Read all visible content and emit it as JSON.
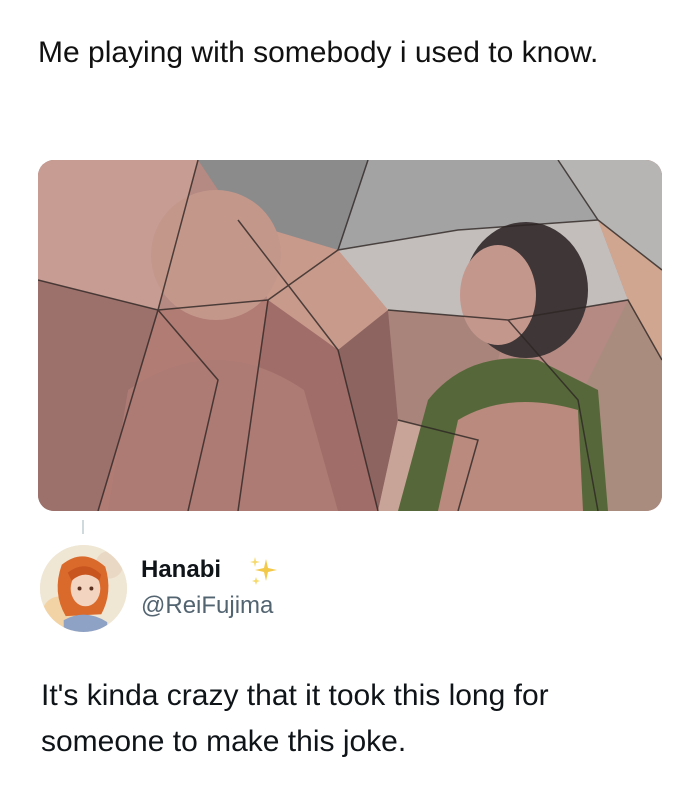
{
  "post": {
    "text": "Me playing with somebody i used to know."
  },
  "media": {
    "icon": "stained-glass-figures-image",
    "colors": {
      "mauve": "#b07f7a",
      "grey": "#8f9499",
      "olive": "#586a3a",
      "dark_hair": "#3a3334"
    }
  },
  "reply": {
    "avatar_icon": "anime-girl-avatar",
    "display_name": "Hanabi",
    "badge_icon": "sparkles-icon",
    "handle": "@ReiFujima",
    "text": "It's kinda crazy that it took this long for someone to make this joke."
  }
}
